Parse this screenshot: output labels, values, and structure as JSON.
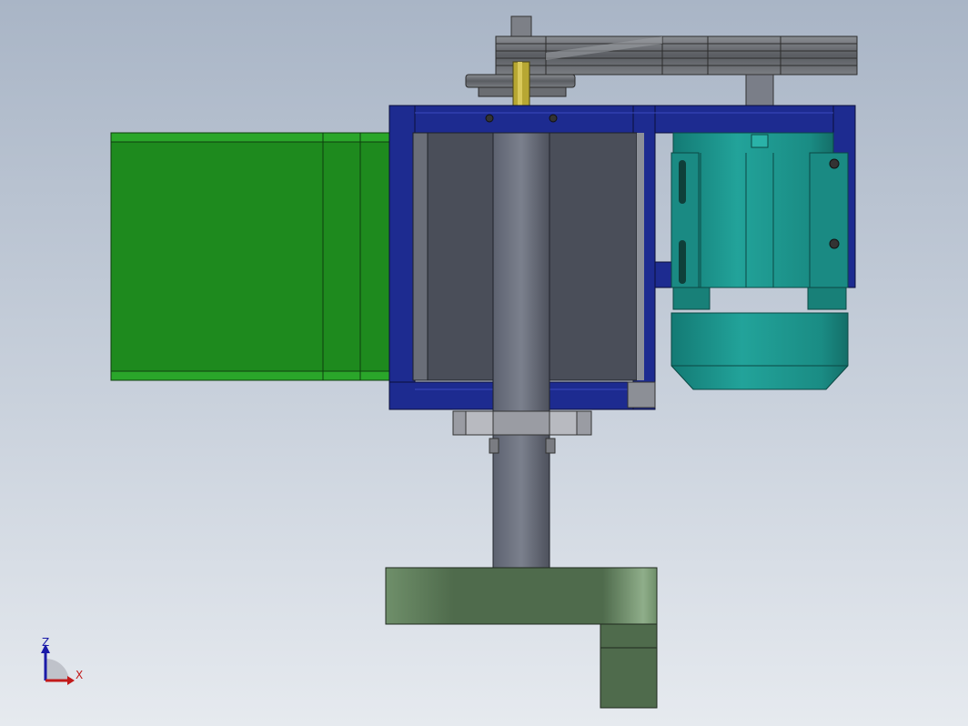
{
  "triad": {
    "z_label": "Z",
    "x_label": "X",
    "z_color": "#1a1aa8",
    "x_color": "#c21a1a"
  },
  "colors": {
    "background_top": "#a9b5c6",
    "background_bottom": "#e6eaef",
    "hopper_green": "#1f8a1f",
    "frame_blue": "#1c2a8c",
    "drum_gray": "#4a4e5a",
    "motor_teal": "#1f8f88",
    "base_green": "#5f7d5c",
    "pulley_gray": "#6f7277",
    "shaft_yellow": "#b8a636"
  }
}
